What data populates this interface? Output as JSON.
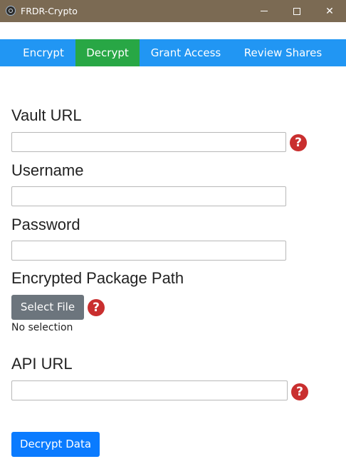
{
  "window": {
    "title": "FRDR-Crypto",
    "icon": "app-logo-icon",
    "controls": {
      "minimize_icon": "minimize-icon",
      "maximize_icon": "maximize-icon",
      "close_icon": "close-icon",
      "close_glyph": "✕"
    }
  },
  "nav": {
    "active_color": "#28a745",
    "bar_color": "#2196f3",
    "tabs": [
      {
        "label": "Encrypt"
      },
      {
        "label": "Decrypt"
      },
      {
        "label": "Grant Access"
      },
      {
        "label": "Review Shares"
      }
    ]
  },
  "form": {
    "vault_url": {
      "label": "Vault URL",
      "value": ""
    },
    "username": {
      "label": "Username",
      "value": ""
    },
    "password": {
      "label": "Password",
      "value": ""
    },
    "package_path": {
      "label": "Encrypted Package Path",
      "button": "Select File",
      "status": "No selection"
    },
    "api_url": {
      "label": "API URL",
      "value": ""
    },
    "help_glyph": "?",
    "submit": "Decrypt Data"
  }
}
